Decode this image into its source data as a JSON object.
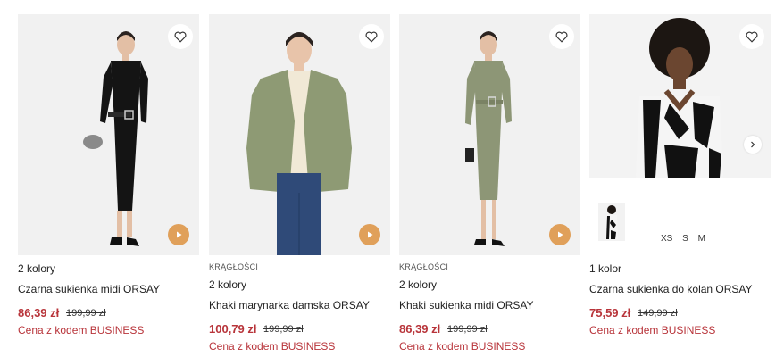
{
  "colors": {
    "price": "#b8343a",
    "play_button": "#e0a05a",
    "image_bg": "#f1f1f1"
  },
  "products": [
    {
      "tag": "",
      "color_count": "2 kolory",
      "name": "Czarna sukienka midi ORSAY",
      "price": "86,39 zł",
      "old_price": "199,99 zł",
      "promo": "Cena z kodem BUSINESS",
      "icons": [
        "heart-icon",
        "play-icon"
      ]
    },
    {
      "tag": "KRĄGŁOŚCI",
      "color_count": "2 kolory",
      "name": "Khaki marynarka damska ORSAY",
      "price": "100,79 zł",
      "old_price": "199,99 zł",
      "promo": "Cena z kodem BUSINESS",
      "icons": [
        "heart-icon",
        "play-icon"
      ]
    },
    {
      "tag": "KRĄGŁOŚCI",
      "color_count": "2 kolory",
      "name": "Khaki sukienka midi ORSAY",
      "price": "86,39 zł",
      "old_price": "199,99 zł",
      "promo": "Cena z kodem BUSINESS",
      "icons": [
        "heart-icon",
        "play-icon"
      ]
    },
    {
      "tag": "",
      "color_count": "1 kolor",
      "name": "Czarna sukienka do kolan ORSAY",
      "price": "75,59 zł",
      "old_price": "149,99 zł",
      "promo": "Cena z kodem BUSINESS",
      "sizes": "XS S M",
      "icons": [
        "heart-icon",
        "chevron-right-icon"
      ]
    }
  ]
}
